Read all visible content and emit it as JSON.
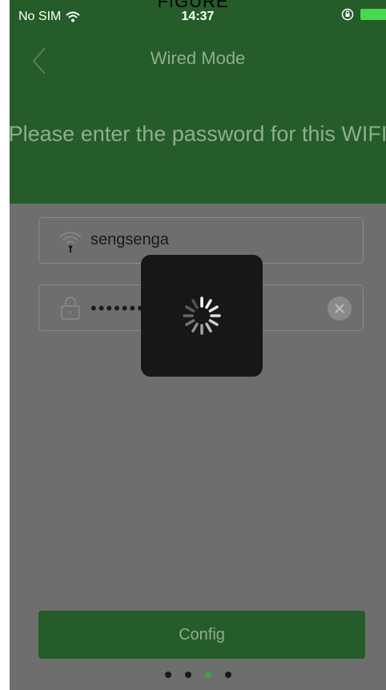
{
  "figure_label": "FIGURE",
  "status_bar": {
    "carrier": "No SIM",
    "time": "14:37"
  },
  "nav": {
    "title": "Wired Mode"
  },
  "prompt": {
    "text": "Please enter the password for this WIFI"
  },
  "ssid_field": {
    "value": "sengsenga"
  },
  "password_field": {
    "value": "12345678",
    "placeholder": ""
  },
  "config_button": {
    "label": "Config"
  },
  "page_indicator": {
    "count": 4,
    "active_index": 2
  },
  "colors": {
    "header_green": "#255c29",
    "accent_green": "#3aa64a",
    "battery_green": "#47d94f",
    "overlay_gray": "#6e6e6e"
  },
  "icons": {
    "back": "chevron-left-icon",
    "wifi": "wifi-icon",
    "lock": "lock-icon",
    "clear": "close-circle-icon",
    "orientation_lock": "orientation-lock-icon",
    "battery": "battery-icon",
    "spinner": "loading-spinner-icon"
  }
}
